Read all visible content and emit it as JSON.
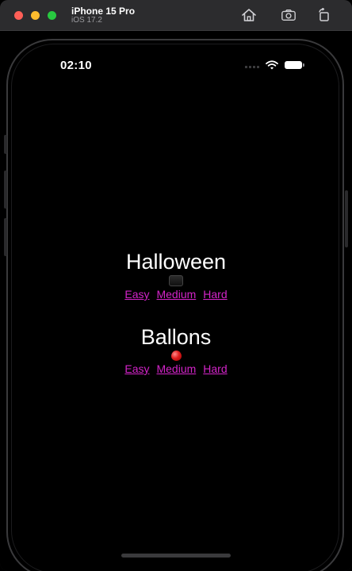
{
  "window": {
    "device_name": "iPhone 15 Pro",
    "os_version": "iOS 17.2"
  },
  "status_bar": {
    "time": "02:10"
  },
  "sections": [
    {
      "title": "Halloween",
      "icon": "pumpkin-icon",
      "levels": [
        "Easy",
        "Medium",
        "Hard"
      ]
    },
    {
      "title": "Ballons",
      "icon": "balloon-icon",
      "levels": [
        "Easy",
        "Medium",
        "Hard"
      ]
    }
  ],
  "colors": {
    "link": "#d324c9",
    "background": "#000000",
    "text": "#ffffff"
  }
}
